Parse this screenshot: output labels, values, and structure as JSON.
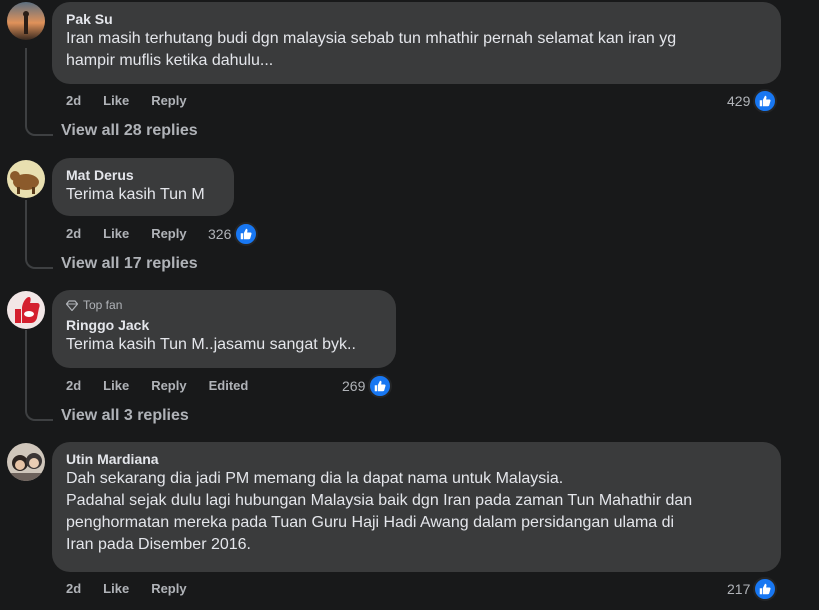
{
  "comments": [
    {
      "author": "Pak Su",
      "lines": [
        "Iran masih terhutang budi dgn malaysia sebab tun mhathir pernah selamat kan iran yg",
        "hampir muflis ketika dahulu..."
      ],
      "time": "2d",
      "like": "Like",
      "reply": "Reply",
      "reactions": "429",
      "view_replies": "View all 28 replies"
    },
    {
      "author": "Mat Derus",
      "lines": [
        "Terima kasih Tun M"
      ],
      "time": "2d",
      "like": "Like",
      "reply": "Reply",
      "reactions": "326",
      "view_replies": "View all 17 replies"
    },
    {
      "badge": "Top fan",
      "author": "Ringgo Jack",
      "lines": [
        "Terima kasih Tun M..jasamu sangat byk.."
      ],
      "time": "2d",
      "like": "Like",
      "reply": "Reply",
      "edited": "Edited",
      "reactions": "269",
      "view_replies": "View all 3 replies"
    },
    {
      "author": "Utin Mardiana",
      "lines": [
        "Dah sekarang dia jadi PM memang dia la dapat nama untuk Malaysia.",
        "Padahal sejak dulu lagi hubungan Malaysia baik dgn Iran pada zaman Tun Mahathir dan",
        "penghormatan mereka pada Tuan Guru Haji Hadi Awang dalam persidangan ulama di",
        "Iran pada Disember 2016."
      ],
      "time": "2d",
      "like": "Like",
      "reply": "Reply",
      "reactions": "217"
    }
  ],
  "colors": {
    "background": "#18191a",
    "bubble": "#3a3b3c",
    "muted": "#b0b3b8",
    "like_blue": "#1877f2"
  }
}
